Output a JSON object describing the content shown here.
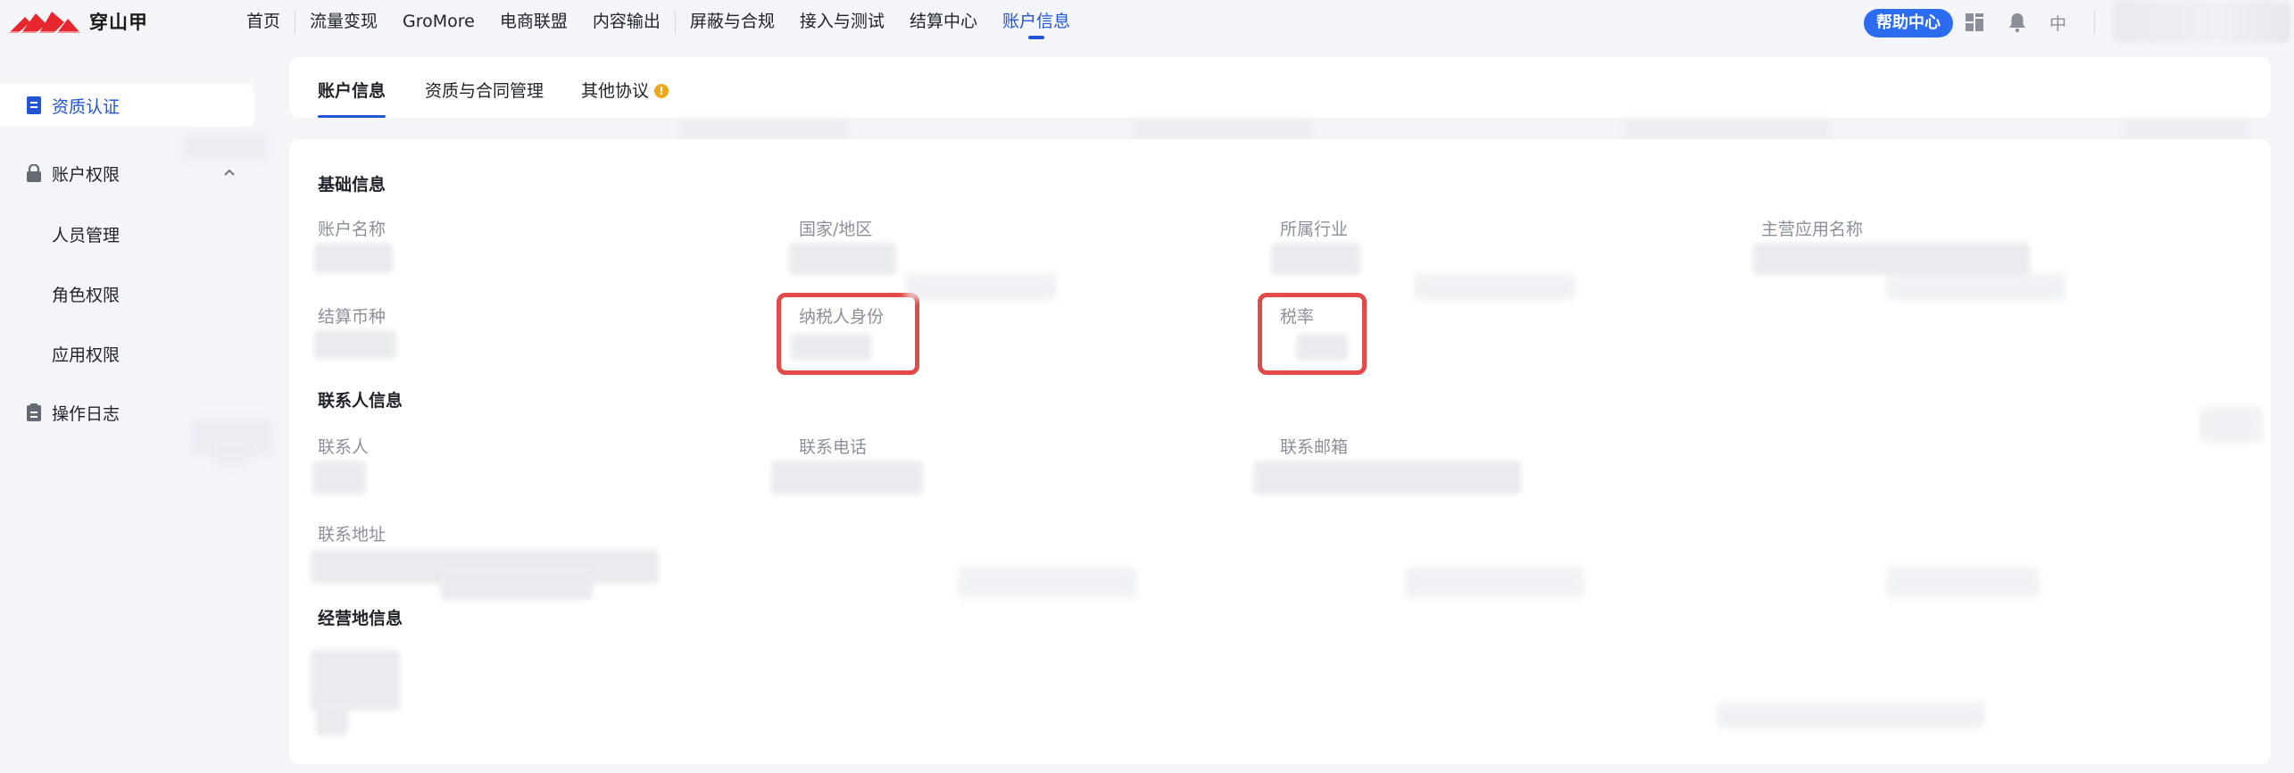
{
  "brand": {
    "name": "穿山甲"
  },
  "nav": {
    "items": [
      {
        "label": "首页"
      },
      {
        "label": "流量变现"
      },
      {
        "label": "GroMore"
      },
      {
        "label": "电商联盟"
      },
      {
        "label": "内容输出"
      },
      {
        "label": "屏蔽与合规"
      },
      {
        "label": "接入与测试"
      },
      {
        "label": "结算中心"
      },
      {
        "label": "账户信息",
        "active": true
      }
    ],
    "help_label": "帮助中心",
    "lang_label": "中"
  },
  "sidebar": {
    "items": [
      {
        "label": "资质认证",
        "icon": "certificate-icon",
        "active": true
      },
      {
        "label": "账户权限",
        "icon": "lock-icon",
        "expanded": true
      },
      {
        "label": "人员管理"
      },
      {
        "label": "角色权限"
      },
      {
        "label": "应用权限"
      },
      {
        "label": "操作日志",
        "icon": "log-icon"
      }
    ]
  },
  "tabs": [
    {
      "label": "账户信息",
      "active": true
    },
    {
      "label": "资质与合同管理"
    },
    {
      "label": "其他协议",
      "badge": "!"
    }
  ],
  "sections": {
    "basic": {
      "title": "基础信息",
      "fields": [
        "账户名称",
        "国家/地区",
        "所属行业",
        "主营应用名称",
        "结算币种",
        "纳税人身份",
        "税率"
      ]
    },
    "contact": {
      "title": "联系人信息",
      "fields": [
        "联系人",
        "联系电话",
        "联系邮箱",
        "联系地址"
      ]
    },
    "business": {
      "title": "经营地信息"
    }
  },
  "colors": {
    "accent": "#2155d6",
    "help_button": "#2c6cf0",
    "highlight": "#e24a4a",
    "warning": "#f0a81a"
  }
}
